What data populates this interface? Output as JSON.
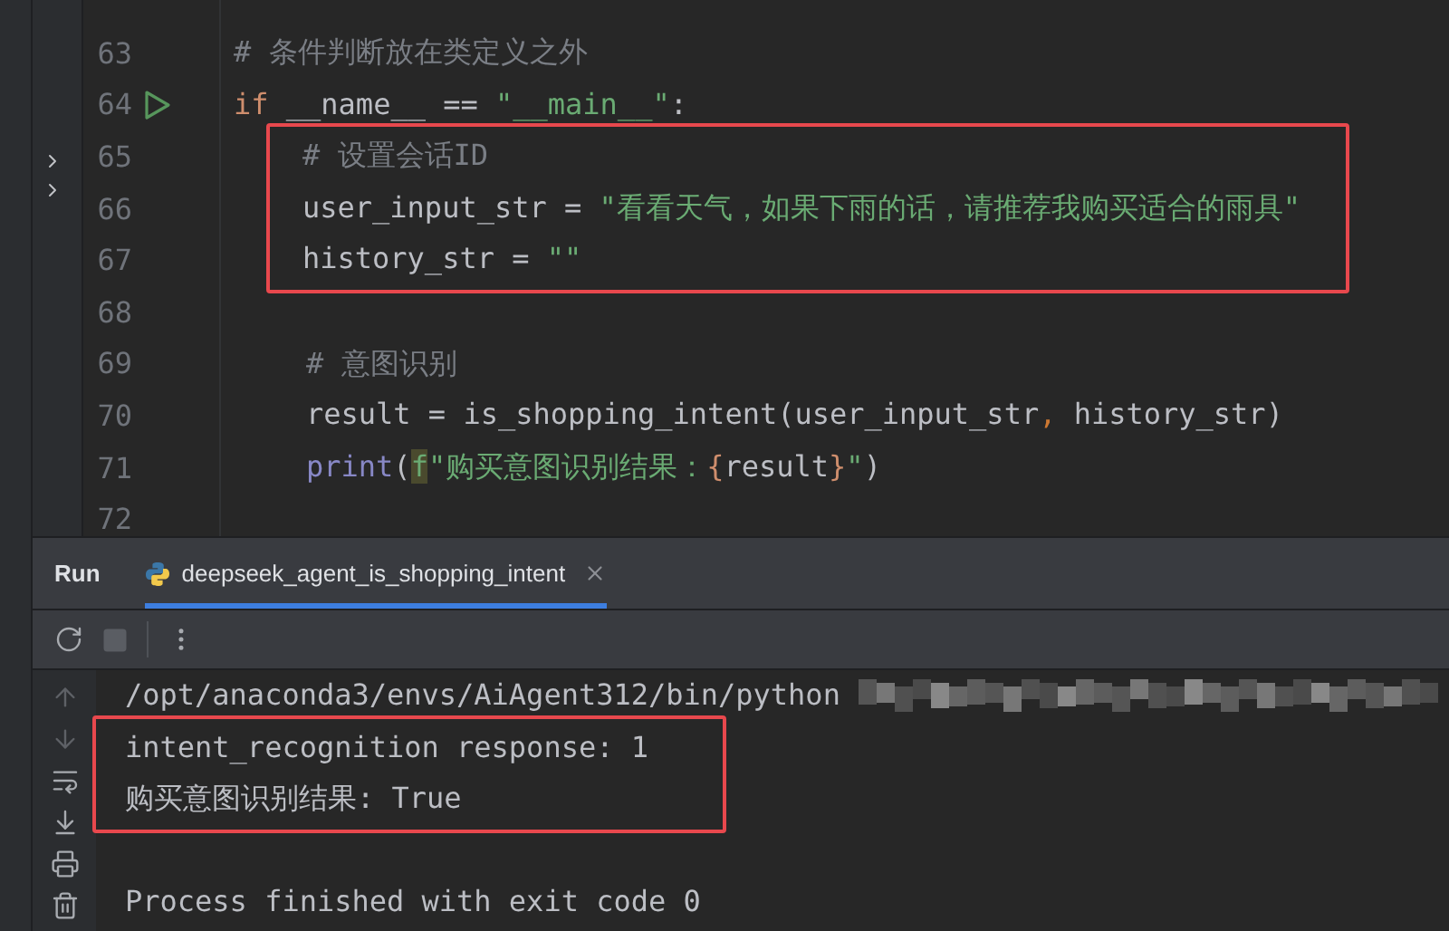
{
  "project_tree": {
    "items": [
      {
        "expanded": false
      },
      {
        "expanded": false
      }
    ]
  },
  "editor": {
    "lines": [
      {
        "number": "63",
        "tokens": [
          {
            "kind": "comment",
            "text": "# 条件判断放在类定义之外"
          }
        ]
      },
      {
        "number": "64",
        "run_marker": true,
        "tokens": [
          {
            "kind": "keyword",
            "text": "if"
          },
          {
            "kind": "plain",
            "text": " __name__ == "
          },
          {
            "kind": "string",
            "text": "\"__main__\""
          },
          {
            "kind": "plain",
            "text": ":"
          }
        ]
      },
      {
        "number": "65",
        "indented": true,
        "highlighted": true,
        "tokens": [
          {
            "kind": "comment",
            "text": "# 设置会话ID"
          }
        ]
      },
      {
        "number": "66",
        "indented": true,
        "highlighted": true,
        "tokens": [
          {
            "kind": "plain",
            "text": "user_input_str = "
          },
          {
            "kind": "string",
            "text": "\"看看天气，如果下雨的话，请推荐我购买适合的雨具\""
          }
        ]
      },
      {
        "number": "67",
        "indented": true,
        "highlighted": true,
        "tokens": [
          {
            "kind": "plain",
            "text": "history_str = "
          },
          {
            "kind": "string",
            "text": "\"\""
          }
        ]
      },
      {
        "number": "68"
      },
      {
        "number": "69",
        "indented": true,
        "tokens": [
          {
            "kind": "comment",
            "text": "# 意图识别"
          }
        ]
      },
      {
        "number": "70",
        "indented": true,
        "tokens": [
          {
            "kind": "plain",
            "text": "result = is_shopping_intent(user_input_str"
          },
          {
            "kind": "comma",
            "text": ","
          },
          {
            "kind": "plain",
            "text": " history_str)"
          }
        ]
      },
      {
        "number": "71",
        "indented": true,
        "tokens": [
          {
            "kind": "builtin",
            "text": "print"
          },
          {
            "kind": "plain",
            "text": "("
          },
          {
            "kind": "fprefix",
            "text": "f"
          },
          {
            "kind": "string",
            "text": "\"购买意图识别结果："
          },
          {
            "kind": "brace",
            "text": "{"
          },
          {
            "kind": "plain",
            "text": "result"
          },
          {
            "kind": "brace",
            "text": "}"
          },
          {
            "kind": "string",
            "text": "\""
          },
          {
            "kind": "plain",
            "text": ")"
          }
        ]
      },
      {
        "number": "72"
      }
    ]
  },
  "run_window": {
    "title": "Run",
    "tabs": [
      {
        "label": "deepseek_agent_is_shopping_intent",
        "selected": true
      }
    ],
    "toolbar": {
      "stop_disabled": true
    },
    "console": {
      "lines": [
        {
          "text": "/opt/anaconda3/envs/AiAgent312/bin/python",
          "redacted": true
        },
        {
          "text": "intent_recognition response: 1",
          "highlighted": true
        },
        {
          "text": "购买意图识别结果: True",
          "highlighted": true
        },
        {
          "text": "Process finished with exit code 0",
          "blank_line_before": true
        }
      ]
    }
  }
}
